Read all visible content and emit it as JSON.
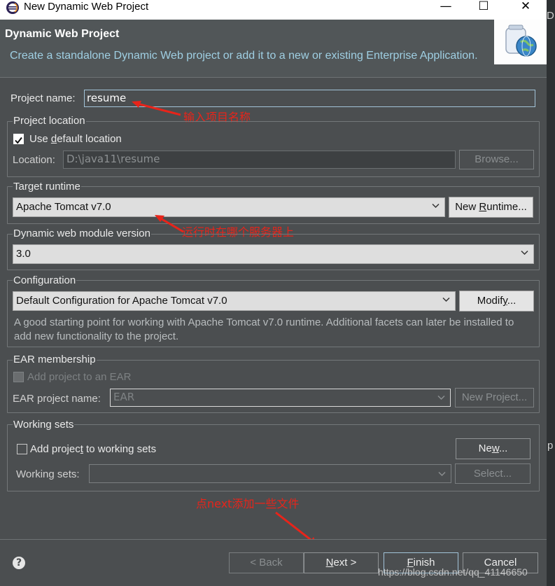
{
  "window": {
    "title": "New Dynamic Web Project",
    "minimize_glyph": "—",
    "maximize_glyph": "☐",
    "close_glyph": "✕"
  },
  "header": {
    "title": "Dynamic Web Project",
    "description": "Create a standalone Dynamic Web project or add it to a new or existing Enterprise Application."
  },
  "project_name": {
    "label": "Project name:",
    "value": "resume"
  },
  "project_location": {
    "legend": "Project location",
    "use_default_pre": "Use ",
    "use_default_mnemonic": "d",
    "use_default_post": "efault location",
    "use_default_checked": true,
    "location_label": "Location:",
    "location_value": "D:\\java11\\resume",
    "browse_label": "Browse..."
  },
  "target_runtime": {
    "legend": "Target runtime",
    "value": "Apache Tomcat v7.0",
    "new_runtime_pre": "New ",
    "new_runtime_mnemonic": "R",
    "new_runtime_post": "untime..."
  },
  "module_version": {
    "legend": "Dynamic web module version",
    "value": "3.0"
  },
  "configuration": {
    "legend": "Configuration",
    "value": "Default Configuration for Apache Tomcat v7.0",
    "modify_pre": "Modif",
    "modify_mnemonic": "y",
    "modify_post": "...",
    "description": "A good starting point for working with Apache Tomcat v7.0 runtime. Additional facets can later be installed to add new functionality to the project."
  },
  "ear": {
    "legend": "EAR membership",
    "add_label": "Add project to an EAR",
    "name_label": "EAR project name:",
    "name_value": "EAR",
    "new_project_label": "New Project..."
  },
  "working_sets": {
    "legend": "Working sets",
    "add_pre": "Add projec",
    "add_mnemonic": "t",
    "add_post": " to working sets",
    "new_pre": "Ne",
    "new_mnemonic": "w",
    "new_post": "...",
    "sets_label": "Working sets:",
    "select_label": "Select..."
  },
  "annotations": {
    "project_name": "输入项目名称",
    "runtime": "运行时在哪个服务器上",
    "next": "点next添加一些文件",
    "color": "#e8241a"
  },
  "footer": {
    "help_glyph": "?",
    "back_label": "< Back",
    "next_pre": "",
    "next_mnemonic": "N",
    "next_post": "ext >",
    "finish_pre": "",
    "finish_mnemonic": "F",
    "finish_post": "inish",
    "cancel_label": "Cancel"
  },
  "watermark": "https://blog.csdn.net/qq_41146650",
  "edge_fragments": {
    "right_top": "D",
    "right_mid": "p"
  }
}
